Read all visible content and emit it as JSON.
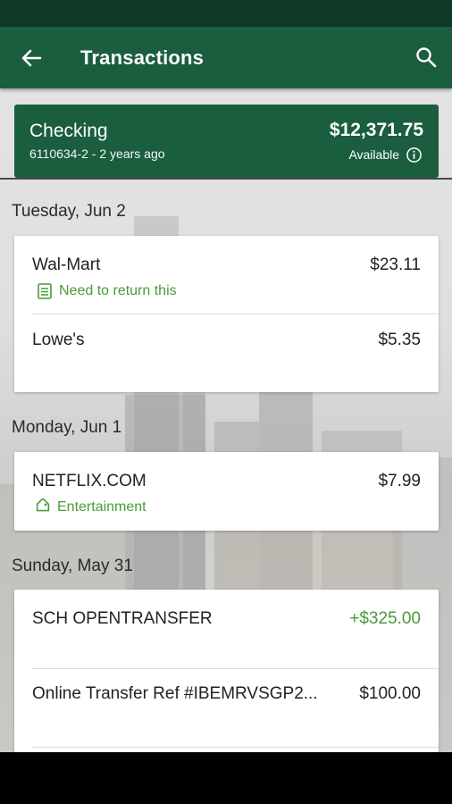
{
  "app_bar": {
    "title": "Transactions",
    "back_icon": "arrow-left-icon",
    "search_icon": "search-icon"
  },
  "account": {
    "name": "Checking",
    "number_age": "6110634-2 - 2 years ago",
    "balance": "$12,371.75",
    "available_label": "Available",
    "info_icon": "info-icon"
  },
  "groups": [
    {
      "date": "Tuesday, Jun 2",
      "transactions": [
        {
          "merchant": "Wal-Mart",
          "amount": "$23.11",
          "note": "Need to return this",
          "note_icon": "note-icon"
        },
        {
          "merchant": "Lowe's",
          "amount": "$5.35"
        }
      ]
    },
    {
      "date": "Monday, Jun 1",
      "transactions": [
        {
          "merchant": "NETFLIX.COM",
          "amount": "$7.99",
          "tag": "Entertainment",
          "tag_icon": "tag-icon"
        }
      ]
    },
    {
      "date": "Sunday, May 31",
      "transactions": [
        {
          "merchant": "SCH OPENTRANSFER",
          "amount": "+$325.00",
          "credit": true
        },
        {
          "merchant": "Online Transfer Ref #IBEMRVSGP2...",
          "amount": "$100.00"
        }
      ]
    }
  ],
  "colors": {
    "primary": "#1a5e3f",
    "status_bar": "#0f3a27",
    "credit_green": "#4a9a3a"
  }
}
